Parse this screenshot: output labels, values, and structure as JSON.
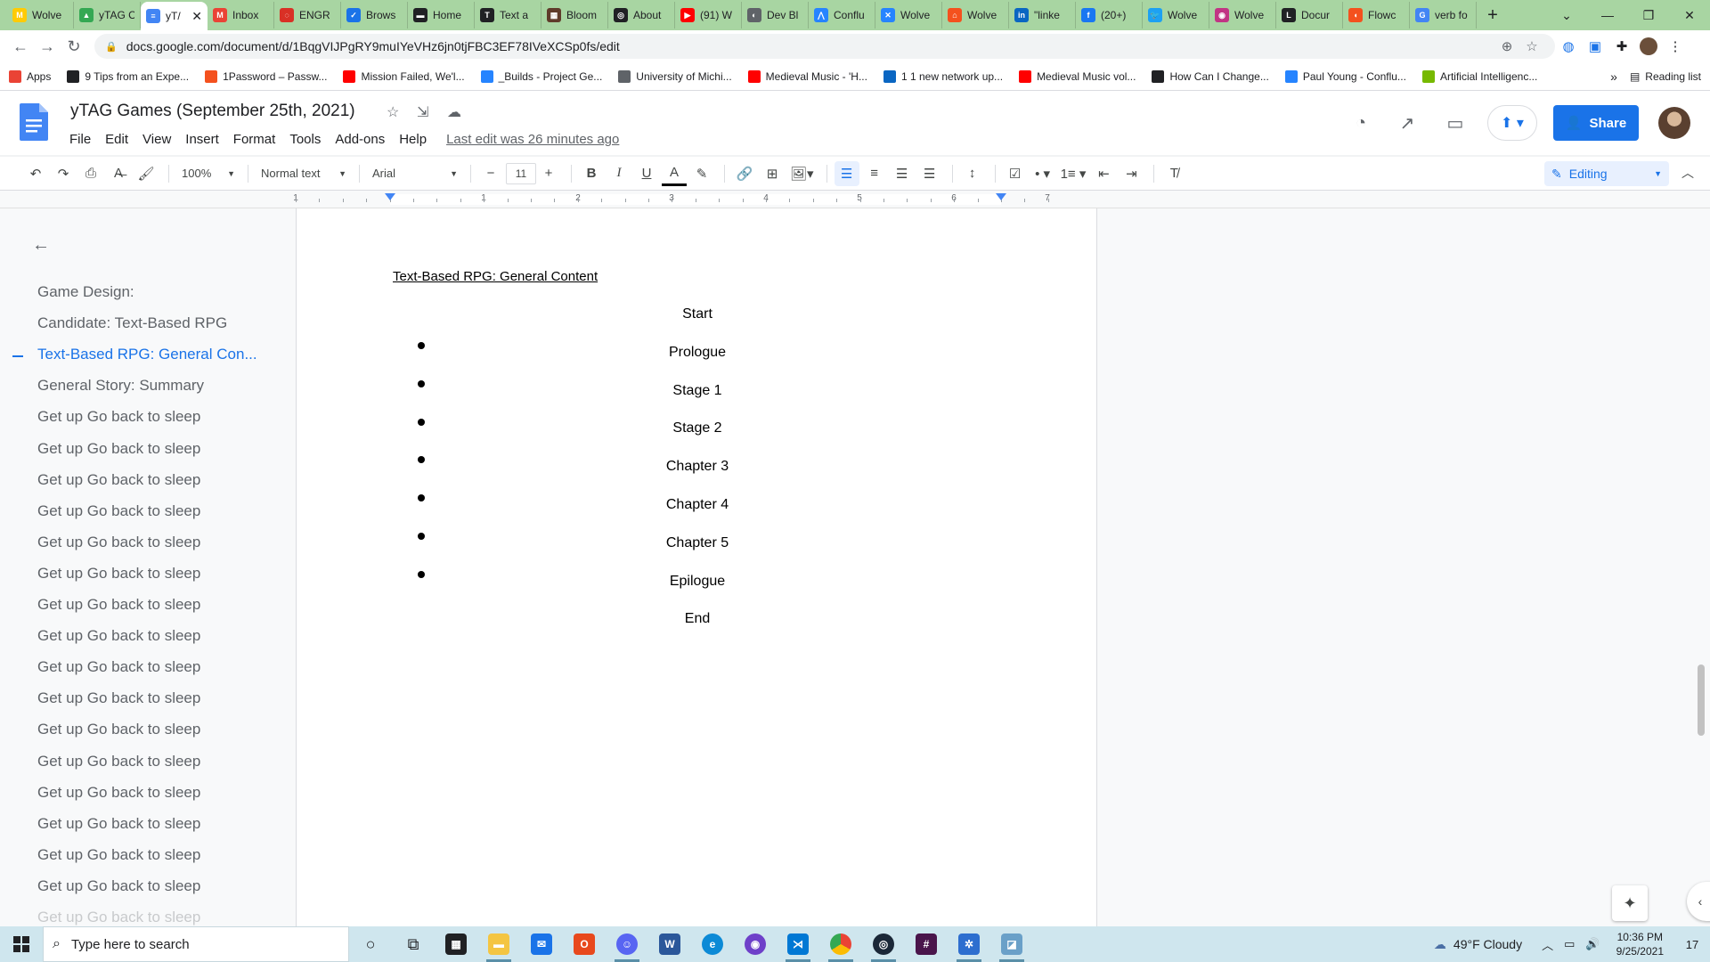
{
  "browser": {
    "tabs": [
      {
        "title": "Wolve",
        "color": "#ffcb05",
        "glyph": "M"
      },
      {
        "title": "yTAG C",
        "color": "#34a853",
        "glyph": "▲"
      },
      {
        "title": "yT/",
        "color": "#4285f4",
        "glyph": "≡",
        "active": true
      },
      {
        "title": "Inbox",
        "color": "#ea4335",
        "glyph": "M"
      },
      {
        "title": "ENGR",
        "color": "#d93025",
        "glyph": "◌"
      },
      {
        "title": "Brows",
        "color": "#1a73e8",
        "glyph": "✓"
      },
      {
        "title": "Home",
        "color": "#202124",
        "glyph": "▬"
      },
      {
        "title": "Text a",
        "color": "#202124",
        "glyph": "T"
      },
      {
        "title": "Bloom",
        "color": "#5f3b2a",
        "glyph": "▦"
      },
      {
        "title": "About",
        "color": "#202124",
        "glyph": "◎"
      },
      {
        "title": "(91) W",
        "color": "#ff0000",
        "glyph": "▶"
      },
      {
        "title": "Dev Bl",
        "color": "#5f6368",
        "glyph": "◐"
      },
      {
        "title": "Conflu",
        "color": "#2684ff",
        "glyph": "⋀"
      },
      {
        "title": "Wolve",
        "color": "#2684ff",
        "glyph": "✕"
      },
      {
        "title": "Wolve",
        "color": "#f4511e",
        "glyph": "⌂"
      },
      {
        "title": "\"linke",
        "color": "#0a66c2",
        "glyph": "in"
      },
      {
        "title": "(20+)",
        "color": "#1877f2",
        "glyph": "f"
      },
      {
        "title": "Wolve",
        "color": "#1da1f2",
        "glyph": "🐦"
      },
      {
        "title": "Wolve",
        "color": "#c13584",
        "glyph": "◉"
      },
      {
        "title": "Docur",
        "color": "#202124",
        "glyph": "L"
      },
      {
        "title": "Flowc",
        "color": "#f4511e",
        "glyph": "◖"
      },
      {
        "title": "verb fo",
        "color": "#4285f4",
        "glyph": "G"
      }
    ],
    "url": "docs.google.com/document/d/1BqgVIJPgRY9muIYeVHz6jn0tjFBC3EF78IVeXCSp0fs/edit",
    "bookmarks": [
      {
        "label": "Apps",
        "color": "#ea4335"
      },
      {
        "label": "9 Tips from an Expe...",
        "color": "#202124"
      },
      {
        "label": "1Password – Passw...",
        "color": "#f4511e"
      },
      {
        "label": "Mission Failed, We'l...",
        "color": "#ff0000"
      },
      {
        "label": "_Builds - Project Ge...",
        "color": "#2684ff"
      },
      {
        "label": "University of Michi...",
        "color": "#5f6368"
      },
      {
        "label": "Medieval Music - 'H...",
        "color": "#ff0000"
      },
      {
        "label": "1 1 new network up...",
        "color": "#0a66c2"
      },
      {
        "label": "Medieval Music vol...",
        "color": "#ff0000"
      },
      {
        "label": "How Can I Change...",
        "color": "#202124"
      },
      {
        "label": "Paul Young - Conflu...",
        "color": "#2684ff"
      },
      {
        "label": "Artificial Intelligenc...",
        "color": "#76b900"
      }
    ],
    "bookmarks_more": "»",
    "reading_list": "Reading list"
  },
  "docs": {
    "title": "yTAG Games (September 25th, 2021)",
    "menu": [
      "File",
      "Edit",
      "View",
      "Insert",
      "Format",
      "Tools",
      "Add-ons",
      "Help"
    ],
    "last_edit": "Last edit was 26 minutes ago",
    "share_label": "Share",
    "toolbar": {
      "zoom": "100%",
      "style": "Normal text",
      "font": "Arial",
      "font_size": "11",
      "mode": "Editing"
    },
    "ruler_numbers": [
      "1",
      "1",
      "2",
      "3",
      "4",
      "5",
      "6",
      "7"
    ],
    "outline": [
      "Game Design:",
      "Candidate: Text-Based RPG",
      "Text-Based RPG: General Con...",
      "General Story: Summary",
      "Get up Go back to sleep",
      "Get up Go back to sleep",
      "Get up Go back to sleep",
      "Get up Go back to sleep",
      "Get up Go back to sleep",
      "Get up Go back to sleep",
      "Get up Go back to sleep",
      "Get up Go back to sleep",
      "Get up Go back to sleep",
      "Get up Go back to sleep",
      "Get up Go back to sleep",
      "Get up Go back to sleep",
      "Get up Go back to sleep",
      "Get up Go back to sleep",
      "Get up Go back to sleep",
      "Get up Go back to sleep",
      "Get up Go back to sleep"
    ],
    "outline_active_index": 2,
    "heading": "Text-Based RPG: General Content",
    "lines": [
      "Start",
      "Prologue",
      "Stage 1",
      "Stage 2",
      "Chapter 3",
      "Chapter 4",
      "Chapter 5",
      "Epilogue",
      "End"
    ]
  },
  "taskbar": {
    "search_placeholder": "Type here to search",
    "weather": "49°F  Cloudy",
    "time": "10:36 PM",
    "date": "9/25/2021",
    "notifications": "17"
  },
  "colors": {
    "accent": "#1a73e8",
    "tabstrip": "#a8d5a2"
  }
}
